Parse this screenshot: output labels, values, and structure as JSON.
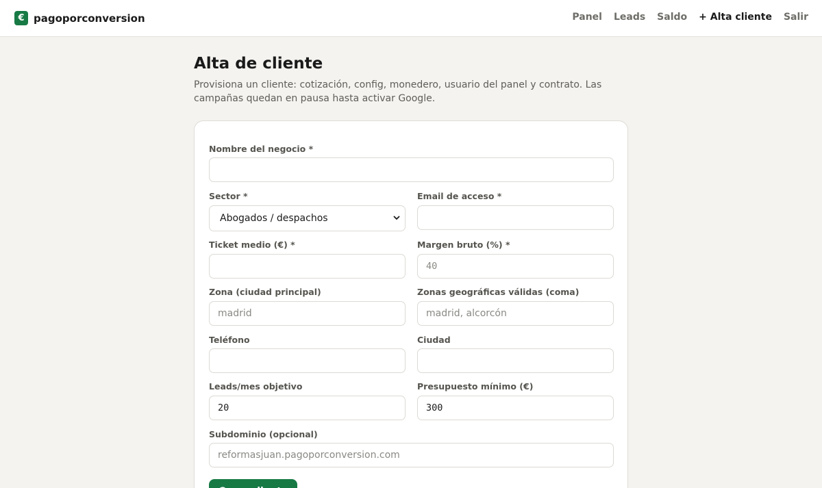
{
  "brand": {
    "icon": "euro-icon",
    "icon_char": "€",
    "name": "pagoporconversion",
    "color": "#177a45"
  },
  "nav": {
    "items": [
      {
        "label": "Panel"
      },
      {
        "label": "Leads"
      },
      {
        "label": "Saldo"
      },
      {
        "label": "+ Alta cliente",
        "active": true
      },
      {
        "label": "Salir"
      }
    ]
  },
  "page": {
    "title": "Alta de cliente",
    "subtitle": "Provisiona un cliente: cotización, config, monedero, usuario del panel y contrato. Las campañas quedan en pausa hasta activar Google."
  },
  "form": {
    "business_name": {
      "label": "Nombre del negocio *",
      "value": "",
      "placeholder": ""
    },
    "sector": {
      "label": "Sector *",
      "selected": "Abogados / despachos",
      "icon": "chevron-down-icon"
    },
    "email": {
      "label": "Email de acceso *",
      "value": "",
      "placeholder": ""
    },
    "ticket": {
      "label": "Ticket medio (€) *",
      "value": "",
      "placeholder": ""
    },
    "margin": {
      "label": "Margen bruto (%) *",
      "value": "",
      "placeholder": "40"
    },
    "zone": {
      "label": "Zona (ciudad principal)",
      "value": "",
      "placeholder": "madrid"
    },
    "geo_zones": {
      "label": "Zonas geográficas válidas (coma)",
      "value": "",
      "placeholder": "madrid, alcorcón"
    },
    "phone": {
      "label": "Teléfono",
      "value": "",
      "placeholder": ""
    },
    "city": {
      "label": "Ciudad",
      "value": "",
      "placeholder": ""
    },
    "leads_target": {
      "label": "Leads/mes objetivo",
      "value": "20"
    },
    "min_budget": {
      "label": "Presupuesto mínimo (€)",
      "value": "300"
    },
    "subdomain": {
      "label": "Subdominio (opcional)",
      "value": "",
      "placeholder": "reformasjuan.pagoporconversion.com"
    },
    "submit_label": "Crear cliente"
  }
}
